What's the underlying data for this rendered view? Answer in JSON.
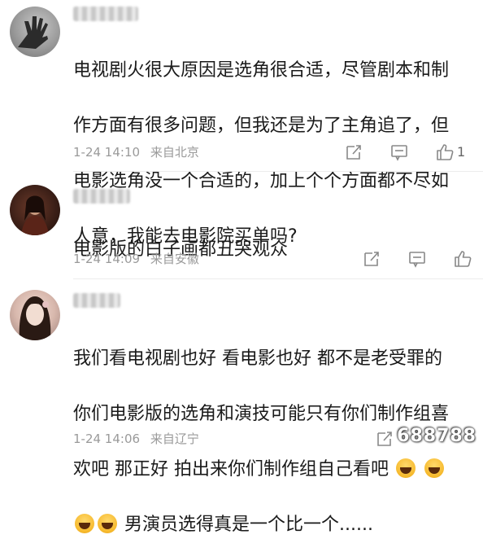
{
  "comments": [
    {
      "username": "",
      "text_lines": [
        "电视剧火很大原因是选角很合适，尽管剧本和制",
        "作方面有很多问题，但我还是为了主角追了，但",
        "电影选角没一个合适的，加上个个方面都不尽如",
        "人意，我能去电影院买单吗?"
      ],
      "date": "1-24 14:10",
      "location": "来自北京",
      "likes": "1"
    },
    {
      "username": "",
      "text_lines": [
        "电影版的白子画都丑哭观众"
      ],
      "date": "1-24 14:09",
      "location": "来自安徽",
      "likes": ""
    },
    {
      "username": "",
      "text_line1": "我们看电视剧也好 看电影也好 都不是老受罪的",
      "text_line2": "你们电影版的选角和演技可能只有你们制作组喜",
      "text_line3": "欢吧  那正好 拍出来你们制作组自己看吧",
      "text_line4": "男演员选得真是一个比一个......",
      "date": "1-24 14:06",
      "location": "来自辽宁",
      "likes": ""
    }
  ],
  "icons": [
    "share-icon",
    "comment-icon",
    "like-icon"
  ],
  "watermark": "688788"
}
